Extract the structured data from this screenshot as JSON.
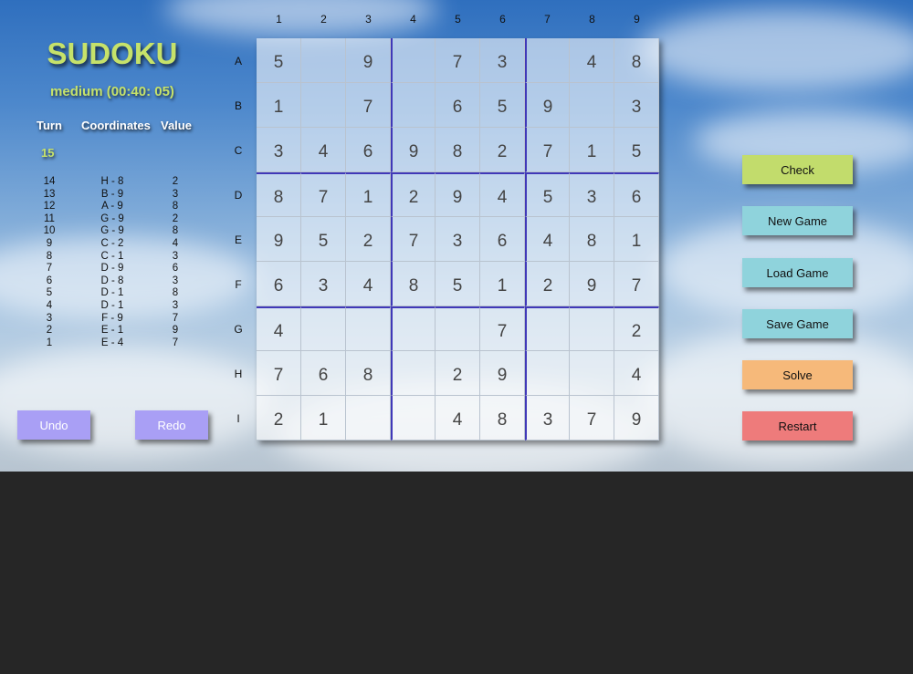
{
  "title": "SUDOKU",
  "difficulty_label": "medium (00:40: 05)",
  "headers": {
    "turn": "Turn",
    "coordinates": "Coordinates",
    "value": "Value"
  },
  "current_turn": "15",
  "history": [
    {
      "turn": "14",
      "coord": "H - 8",
      "value": "2"
    },
    {
      "turn": "13",
      "coord": "B - 9",
      "value": "3"
    },
    {
      "turn": "12",
      "coord": "A - 9",
      "value": "8"
    },
    {
      "turn": "11",
      "coord": "G - 9",
      "value": "2"
    },
    {
      "turn": "10",
      "coord": "G - 9",
      "value": "8"
    },
    {
      "turn": "9",
      "coord": "C - 2",
      "value": "4"
    },
    {
      "turn": "8",
      "coord": "C - 1",
      "value": "3"
    },
    {
      "turn": "7",
      "coord": "D - 9",
      "value": "6"
    },
    {
      "turn": "6",
      "coord": "D - 8",
      "value": "3"
    },
    {
      "turn": "5",
      "coord": "D - 1",
      "value": "8"
    },
    {
      "turn": "4",
      "coord": "D - 1",
      "value": "3"
    },
    {
      "turn": "3",
      "coord": "F - 9",
      "value": "7"
    },
    {
      "turn": "2",
      "coord": "E - 1",
      "value": "9"
    },
    {
      "turn": "1",
      "coord": "E - 4",
      "value": "7"
    }
  ],
  "undo_label": "Undo",
  "redo_label": "Redo",
  "col_labels": [
    "1",
    "2",
    "3",
    "4",
    "5",
    "6",
    "7",
    "8",
    "9"
  ],
  "row_labels": [
    "A",
    "B",
    "C",
    "D",
    "E",
    "F",
    "G",
    "H",
    "I"
  ],
  "grid": [
    [
      "5",
      "",
      "9",
      "",
      "7",
      "3",
      "",
      "4",
      "8"
    ],
    [
      "1",
      "",
      "7",
      "",
      "6",
      "5",
      "9",
      "",
      "3"
    ],
    [
      "3",
      "4",
      "6",
      "9",
      "8",
      "2",
      "7",
      "1",
      "5"
    ],
    [
      "8",
      "7",
      "1",
      "2",
      "9",
      "4",
      "5",
      "3",
      "6"
    ],
    [
      "9",
      "5",
      "2",
      "7",
      "3",
      "6",
      "4",
      "8",
      "1"
    ],
    [
      "6",
      "3",
      "4",
      "8",
      "5",
      "1",
      "2",
      "9",
      "7"
    ],
    [
      "4",
      "",
      "",
      "",
      "",
      "7",
      "",
      "",
      "2"
    ],
    [
      "7",
      "6",
      "8",
      "",
      "2",
      "9",
      "",
      "",
      "4"
    ],
    [
      "2",
      "1",
      "",
      "",
      "4",
      "8",
      "3",
      "7",
      "9"
    ]
  ],
  "actions": [
    {
      "label": "Check",
      "name": "check-button",
      "color": "#c2dc6c"
    },
    {
      "label": "New Game",
      "name": "new-game-button",
      "color": "#8fd3dc"
    },
    {
      "label": "Load Game",
      "name": "load-game-button",
      "color": "#8fd3dc"
    },
    {
      "label": "Save Game",
      "name": "save-game-button",
      "color": "#8fd3dc"
    },
    {
      "label": "Solve",
      "name": "solve-button",
      "color": "#f6b97a"
    },
    {
      "label": "Restart",
      "name": "restart-button",
      "color": "#ee7b7b"
    }
  ],
  "colors": {
    "title": "#c6e26a",
    "grid_border": "#4038b8",
    "history_button": "#a99ff5",
    "background": "#262626"
  }
}
